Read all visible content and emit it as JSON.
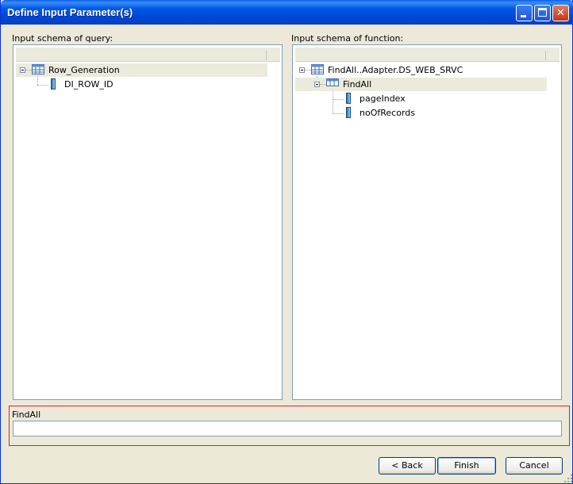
{
  "window": {
    "title": "Define Input Parameter(s)"
  },
  "left_panel": {
    "label": "Input schema of query:",
    "tree": [
      {
        "text": "Row_Generation",
        "icon": "table-icon",
        "expanded": true,
        "selected": true
      },
      {
        "text": "DI_ROW_ID",
        "icon": "column-icon"
      }
    ]
  },
  "right_panel": {
    "label": "Input schema of function:",
    "tree": [
      {
        "text": "FindAll..Adapter.DS_WEB_SRVC",
        "icon": "table-icon",
        "expanded": true
      },
      {
        "text": "FindAll",
        "icon": "nested-table-icon",
        "expanded": true,
        "selected": true
      },
      {
        "text": "pageIndex",
        "icon": "column-icon"
      },
      {
        "text": "noOfRecords",
        "icon": "column-icon"
      }
    ]
  },
  "expression": {
    "label": "FindAll",
    "value": ""
  },
  "buttons": {
    "back": "< Back",
    "finish": "Finish",
    "cancel": "Cancel"
  },
  "colors": {
    "title_bar": "#0058e6",
    "group_border": "#e0202a",
    "selection": "#ebeadb"
  }
}
